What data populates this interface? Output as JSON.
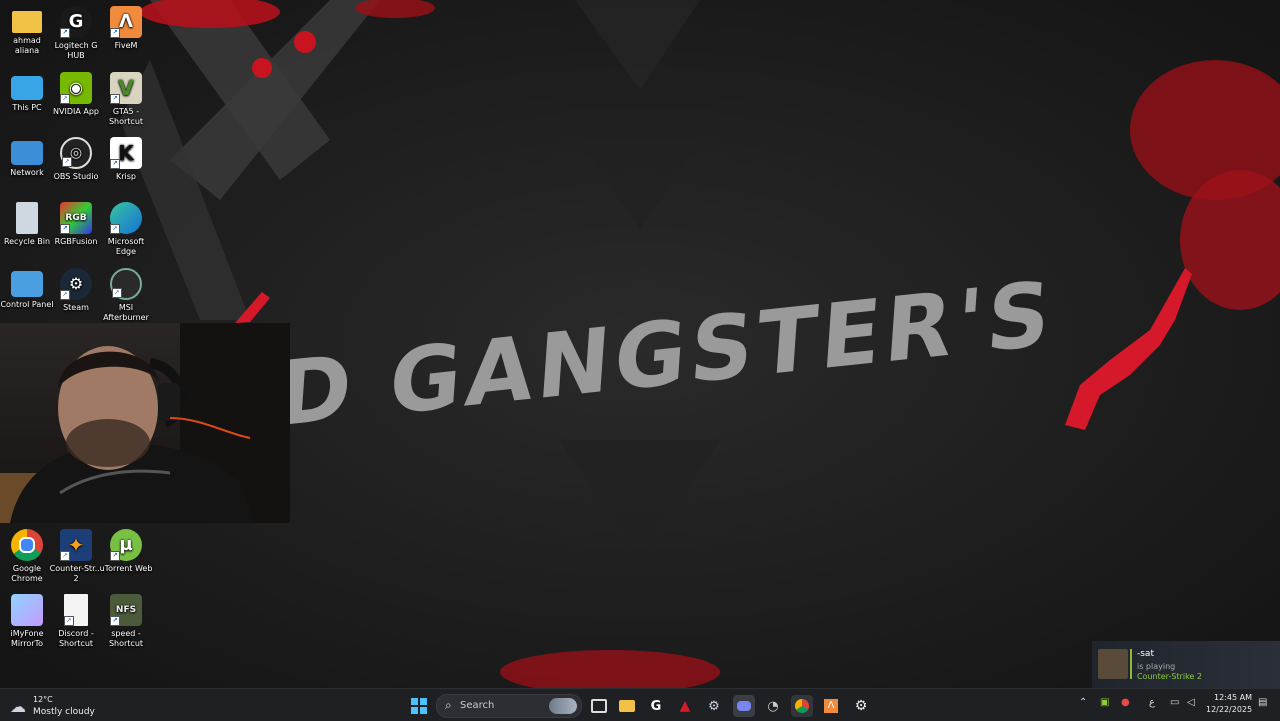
{
  "wallpaper": {
    "title": "OLD GANGSTER'S"
  },
  "desktop": {
    "icons_top": [
      {
        "label": "ahmad aliana"
      },
      {
        "label": "Logitech G HUB"
      },
      {
        "label": "FiveM"
      },
      {
        "label": "This PC"
      },
      {
        "label": "NVIDIA App"
      },
      {
        "label": "GTA5 - Shortcut"
      },
      {
        "label": "Network"
      },
      {
        "label": "OBS Studio"
      },
      {
        "label": "Krisp"
      },
      {
        "label": "Recycle Bin"
      },
      {
        "label": "RGBFusion"
      },
      {
        "label": "Microsoft Edge"
      },
      {
        "label": "Control Panel"
      },
      {
        "label": "Steam"
      },
      {
        "label": "MSI Afterburner"
      }
    ],
    "icons_bottom": [
      {
        "label": "Google Chrome"
      },
      {
        "label": "Counter-Str... 2"
      },
      {
        "label": "uTorrent Web"
      },
      {
        "label": "iMyFone MirrorTo"
      },
      {
        "label": "Discord - Shortcut"
      },
      {
        "label": "speed - Shortcut"
      }
    ]
  },
  "toast": {
    "name": "-sat",
    "status": "is playing",
    "game": "Counter-Strike 2"
  },
  "taskbar": {
    "weather_temp": "12°C",
    "weather_desc": "Mostly cloudy",
    "search_label": "Search",
    "lang": "ع",
    "time": "12:45 AM",
    "date": "12/22/2025"
  }
}
